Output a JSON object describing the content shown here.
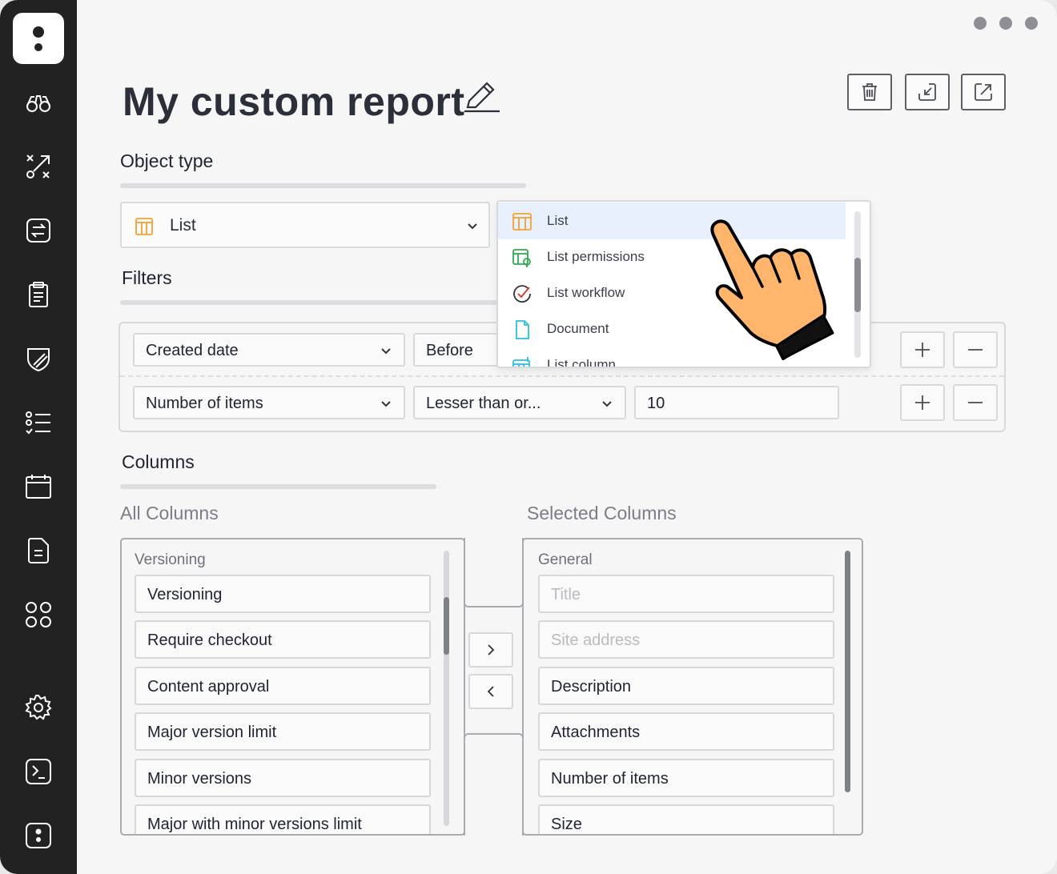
{
  "window": {
    "controls": [
      "dot",
      "dot",
      "dot"
    ]
  },
  "sidebar": {
    "items": [
      {
        "icon": "binoculars-icon"
      },
      {
        "icon": "strategy-icon"
      },
      {
        "icon": "transfer-icon"
      },
      {
        "icon": "clipboard-icon"
      },
      {
        "icon": "shield-icon"
      },
      {
        "icon": "checklist-icon"
      },
      {
        "icon": "calendar-icon"
      },
      {
        "icon": "document-icon"
      },
      {
        "icon": "apps-icon"
      },
      {
        "icon": "settings-icon"
      },
      {
        "icon": "terminal-icon"
      },
      {
        "icon": "app-logo-icon"
      }
    ]
  },
  "header": {
    "title": "My custom report",
    "actions": [
      "trash-icon",
      "import-icon",
      "export-icon"
    ]
  },
  "object_type": {
    "label": "Object type",
    "selected": "List",
    "dropdown": {
      "items": [
        {
          "label": "List",
          "icon": "list-icon",
          "color": "#f0a230",
          "active": true
        },
        {
          "label": "List permissions",
          "icon": "list-permissions-icon",
          "color": "#2eaa4f"
        },
        {
          "label": "List workflow",
          "icon": "workflow-icon",
          "color": "#d9342b"
        },
        {
          "label": "Document",
          "icon": "document-icon",
          "color": "#2bbfe0"
        },
        {
          "label": "List column",
          "icon": "list-column-icon",
          "color": "#2bbfe0"
        }
      ]
    }
  },
  "filters": {
    "label": "Filters",
    "rows": [
      {
        "field": "Created date",
        "operator": "Before",
        "value": ""
      },
      {
        "field": "Number of items",
        "operator": "Lesser than or...",
        "value": "10"
      }
    ]
  },
  "columns": {
    "label": "Columns",
    "all": {
      "title": "All Columns",
      "group": "Versioning",
      "items": [
        "Versioning",
        "Require checkout",
        "Content approval",
        "Major version limit",
        "Minor versions",
        "Major with minor versions limit"
      ]
    },
    "selected": {
      "title": "Selected Columns",
      "group": "General",
      "items": [
        {
          "label": "Title",
          "disabled": true
        },
        {
          "label": "Site address",
          "disabled": true
        },
        {
          "label": "Description",
          "disabled": false
        },
        {
          "label": "Attachments",
          "disabled": false
        },
        {
          "label": "Number of items",
          "disabled": false
        },
        {
          "label": "Size",
          "disabled": false
        }
      ]
    }
  },
  "colors": {
    "accent": "#f0a230",
    "sidebar": "#222222",
    "active_row": "#e9f0fd"
  }
}
